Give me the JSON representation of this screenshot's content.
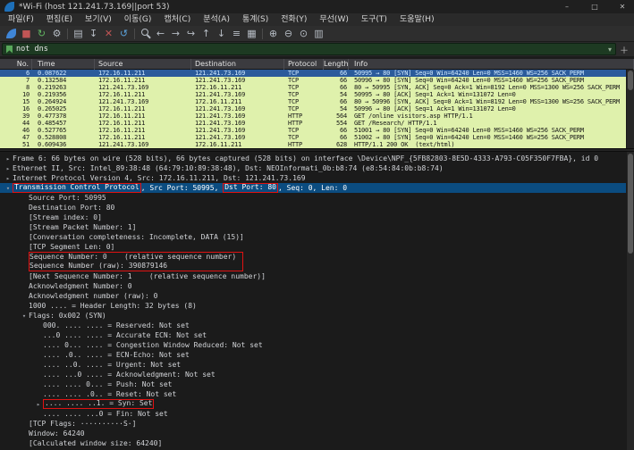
{
  "colors": {
    "packet_row_green": "#dff1ac",
    "selected_row_blue": "#2b5b9b",
    "details_selected_blue": "#0b4c80",
    "annotation_red": "#e01212",
    "filter_valid_green": "#1d3a22"
  },
  "window": {
    "title": "*Wi-Fi (host 121.241.73.169||port 53)",
    "controls": [
      {
        "name": "minimize-button",
        "glyph": "–"
      },
      {
        "name": "maximize-button",
        "glyph": "□"
      },
      {
        "name": "close-button",
        "glyph": "✕"
      }
    ]
  },
  "menu": {
    "items": [
      {
        "id": "file",
        "label": "파일(F)"
      },
      {
        "id": "edit",
        "label": "편집(E)"
      },
      {
        "id": "view",
        "label": "보기(V)"
      },
      {
        "id": "go",
        "label": "이동(G)"
      },
      {
        "id": "capture",
        "label": "캡처(C)"
      },
      {
        "id": "analyze",
        "label": "분석(A)"
      },
      {
        "id": "statistics",
        "label": "통계(S)"
      },
      {
        "id": "telephony",
        "label": "전화(Y)"
      },
      {
        "id": "wireless",
        "label": "무선(W)"
      },
      {
        "id": "tools",
        "label": "도구(T)"
      },
      {
        "id": "help",
        "label": "도움말(H)"
      }
    ]
  },
  "toolbar": {
    "items": [
      {
        "name": "start-capture-icon",
        "kind": "fin"
      },
      {
        "name": "stop-capture-icon",
        "glyph": "■",
        "color": "#c05555"
      },
      {
        "name": "restart-capture-icon",
        "glyph": "↻",
        "color": "#62b562"
      },
      {
        "name": "capture-options-icon",
        "glyph": "⚙",
        "color": "#b6bcc4"
      },
      {
        "sep": true
      },
      {
        "name": "open-file-icon",
        "glyph": "▤",
        "color": "#b6bcc4"
      },
      {
        "name": "save-file-icon",
        "glyph": "↧",
        "color": "#b6bcc4"
      },
      {
        "name": "close-file-icon",
        "glyph": "✕",
        "color": "#c05555"
      },
      {
        "name": "reload-icon",
        "glyph": "↺",
        "color": "#5aa0d8"
      },
      {
        "sep": true
      },
      {
        "name": "find-packet-icon",
        "kind": "mag"
      },
      {
        "name": "go-back-icon",
        "glyph": "←",
        "color": "#b6bcc4"
      },
      {
        "name": "go-forward-icon",
        "glyph": "→",
        "color": "#b6bcc4"
      },
      {
        "name": "go-to-packet-icon",
        "glyph": "↪",
        "color": "#b6bcc4"
      },
      {
        "name": "go-first-icon",
        "glyph": "↑",
        "color": "#b6bcc4"
      },
      {
        "name": "go-last-icon",
        "glyph": "↓",
        "color": "#b6bcc4"
      },
      {
        "name": "auto-scroll-icon",
        "glyph": "≡",
        "color": "#b6bcc4"
      },
      {
        "name": "colorize-icon",
        "glyph": "▦",
        "color": "#b6bcc4"
      },
      {
        "sep": true
      },
      {
        "name": "zoom-in-icon",
        "glyph": "⊕",
        "color": "#b6bcc4"
      },
      {
        "name": "zoom-out-icon",
        "glyph": "⊖",
        "color": "#b6bcc4"
      },
      {
        "name": "zoom-reset-icon",
        "glyph": "⊙",
        "color": "#b6bcc4"
      },
      {
        "name": "resize-columns-icon",
        "glyph": "▥",
        "color": "#b6bcc4"
      }
    ]
  },
  "filter": {
    "value": "not dns",
    "dropdown_glyph": "▾",
    "add_glyph": "＋"
  },
  "packet_list": {
    "columns": [
      {
        "id": "no",
        "label": "No."
      },
      {
        "id": "time",
        "label": "Time"
      },
      {
        "id": "source",
        "label": "Source"
      },
      {
        "id": "destination",
        "label": "Destination"
      },
      {
        "id": "protocol",
        "label": "Protocol"
      },
      {
        "id": "length",
        "label": "Length"
      },
      {
        "id": "info",
        "label": "Info"
      }
    ],
    "rows": [
      {
        "no": "6",
        "time": "0.087622",
        "source": "172.16.11.211",
        "destination": "121.241.73.169",
        "protocol": "TCP",
        "length": "66",
        "info": "50995 → 80 [SYN] Seq=0 Win=64240 Len=0 MSS=1460 WS=256 SACK_PERM",
        "selected": true
      },
      {
        "no": "7",
        "time": "0.132584",
        "source": "172.16.11.211",
        "destination": "121.241.73.169",
        "protocol": "TCP",
        "length": "66",
        "info": "50996 → 80 [SYN] Seq=0 Win=64240 Len=0 MSS=1460 WS=256 SACK_PERM"
      },
      {
        "no": "8",
        "time": "0.219263",
        "source": "121.241.73.169",
        "destination": "172.16.11.211",
        "protocol": "TCP",
        "length": "66",
        "info": "80 → 50995 [SYN, ACK] Seq=0 Ack=1 Win=8192 Len=0 MSS=1300 WS=256 SACK_PERM"
      },
      {
        "no": "10",
        "time": "0.219356",
        "source": "172.16.11.211",
        "destination": "121.241.73.169",
        "protocol": "TCP",
        "length": "54",
        "info": "50995 → 80 [ACK] Seq=1 Ack=1 Win=131072 Len=0"
      },
      {
        "no": "15",
        "time": "0.264924",
        "source": "121.241.73.169",
        "destination": "172.16.11.211",
        "protocol": "TCP",
        "length": "66",
        "info": "80 → 50996 [SYN, ACK] Seq=0 Ack=1 Win=8192 Len=0 MSS=1300 WS=256 SACK_PERM"
      },
      {
        "no": "16",
        "time": "0.265025",
        "source": "172.16.11.211",
        "destination": "121.241.73.169",
        "protocol": "TCP",
        "length": "54",
        "info": "50996 → 80 [ACK] Seq=1 Ack=1 Win=131072 Len=0"
      },
      {
        "no": "39",
        "time": "0.477378",
        "source": "172.16.11.211",
        "destination": "121.241.73.169",
        "protocol": "HTTP",
        "length": "564",
        "info": "GET /online visitors.asp HTTP/1.1"
      },
      {
        "no": "44",
        "time": "0.485457",
        "source": "172.16.11.211",
        "destination": "121.241.73.169",
        "protocol": "HTTP",
        "length": "554",
        "info": "GET /Research/ HTTP/1.1"
      },
      {
        "no": "46",
        "time": "0.527765",
        "source": "172.16.11.211",
        "destination": "121.241.73.169",
        "protocol": "TCP",
        "length": "66",
        "info": "51001 → 80 [SYN] Seq=0 Win=64240 Len=0 MSS=1460 WS=256 SACK_PERM"
      },
      {
        "no": "47",
        "time": "0.528808",
        "source": "172.16.11.211",
        "destination": "121.241.73.169",
        "protocol": "TCP",
        "length": "66",
        "info": "51002 → 80 [SYN] Seq=0 Win=64240 Len=0 MSS=1460 WS=256 SACK_PERM"
      },
      {
        "no": "51",
        "time": "0.609436",
        "source": "121.241.73.169",
        "destination": "172.16.11.211",
        "protocol": "HTTP",
        "length": "628",
        "info": "HTTP/1.1 200 OK  (text/html)"
      }
    ]
  },
  "details": {
    "lines": [
      {
        "indent": 0,
        "arrow": "collapsed",
        "text": "Frame 6: 66 bytes on wire (528 bits), 66 bytes captured (528 bits) on interface \\Device\\NPF_{5FB82803-8E5D-4333-A793-C05F350F7FBA}, id 0"
      },
      {
        "indent": 0,
        "arrow": "collapsed",
        "text": "Ethernet II, Src: Intel_89:38:48 (64:79:10:89:38:48), Dst: NEOInformati_0b:b8:74 (e8:54:84:0b:b8:74)"
      },
      {
        "indent": 0,
        "arrow": "collapsed",
        "text": "Internet Protocol Version 4, Src: 172.16.11.211, Dst: 121.241.73.169"
      },
      {
        "indent": 0,
        "arrow": "expanded",
        "selected": true,
        "segments": [
          {
            "text": "Transmission Control Protocol",
            "redbox": true
          },
          {
            "text": ", Src Port: 50995, "
          },
          {
            "text": "Dst Port: 80",
            "redbox": true
          },
          {
            "text": ", Seq: 0, Len: 0"
          }
        ]
      },
      {
        "indent": 1,
        "text": "Source Port: 50995"
      },
      {
        "indent": 1,
        "text": "Destination Port: 80"
      },
      {
        "indent": 1,
        "text": "[Stream index: 0]"
      },
      {
        "indent": 1,
        "text": "[Stream Packet Number: 1]"
      },
      {
        "indent": 1,
        "text": "[Conversation completeness: Incomplete, DATA (15)]"
      },
      {
        "indent": 1,
        "text": "[TCP Segment Len: 0]"
      },
      {
        "indent": 1,
        "text": "Sequence Number: 0    (relative sequence number)",
        "red_box": "top"
      },
      {
        "indent": 1,
        "text": "Sequence Number (raw): 390879146",
        "red_box": "bottom"
      },
      {
        "indent": 1,
        "text": "[Next Sequence Number: 1    (relative sequence number)]"
      },
      {
        "indent": 1,
        "text": "Acknowledgment Number: 0"
      },
      {
        "indent": 1,
        "text": "Acknowledgment number (raw): 0"
      },
      {
        "indent": 1,
        "text": "1000 .... = Header Length: 32 bytes (8)"
      },
      {
        "indent": 1,
        "arrow": "expanded",
        "text": "Flags: 0x002 (SYN)"
      },
      {
        "indent": 2,
        "text": "000. .... .... = Reserved: Not set"
      },
      {
        "indent": 2,
        "text": "...0 .... .... = Accurate ECN: Not set"
      },
      {
        "indent": 2,
        "text": ".... 0... .... = Congestion Window Reduced: Not set"
      },
      {
        "indent": 2,
        "text": ".... .0.. .... = ECN-Echo: Not set"
      },
      {
        "indent": 2,
        "text": ".... ..0. .... = Urgent: Not set"
      },
      {
        "indent": 2,
        "text": ".... ...0 .... = Acknowledgment: Not set"
      },
      {
        "indent": 2,
        "text": ".... .... 0... = Push: Not set"
      },
      {
        "indent": 2,
        "text": ".... .... .0.. = Reset: Not set"
      },
      {
        "indent": 2,
        "arrow": "collapsed",
        "text": ".... .... ..1. = Syn: Set",
        "red_box": "single"
      },
      {
        "indent": 2,
        "text": ".... .... ...0 = Fin: Not set"
      },
      {
        "indent": 1,
        "text": "[TCP Flags: ··········S·]"
      },
      {
        "indent": 1,
        "text": "Window: 64240"
      },
      {
        "indent": 1,
        "text": "[Calculated window size: 64240]"
      }
    ]
  }
}
